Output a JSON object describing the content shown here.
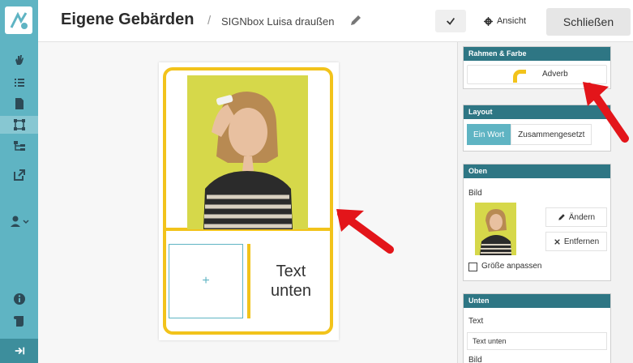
{
  "header": {
    "title": "Eigene Gebärden",
    "crumb_separator": "/",
    "crumb": "SIGNbox Luisa draußen",
    "view_label": "Ansicht",
    "close_label": "Schließen"
  },
  "card": {
    "plus": "+",
    "bottom_text": "Text unten"
  },
  "panel": {
    "frame": {
      "heading": "Rahmen & Farbe",
      "value": "Adverb"
    },
    "layout": {
      "heading": "Layout",
      "option_single": "Ein Wort",
      "option_compound": "Zusammengesetzt"
    },
    "top": {
      "heading": "Oben",
      "image_label": "Bild",
      "change_label": "Ändern",
      "remove_label": "Entfernen",
      "resize_label": "Größe anpassen"
    },
    "bottom": {
      "heading": "Unten",
      "text_label": "Text",
      "text_value": "Text unten",
      "image_label_partial": "Bild"
    }
  },
  "colors": {
    "sidebar": "#5fb4c3",
    "panel_heading": "#2e7684",
    "frame_yellow": "#f2c31b",
    "arrow_red": "#e3151a"
  }
}
